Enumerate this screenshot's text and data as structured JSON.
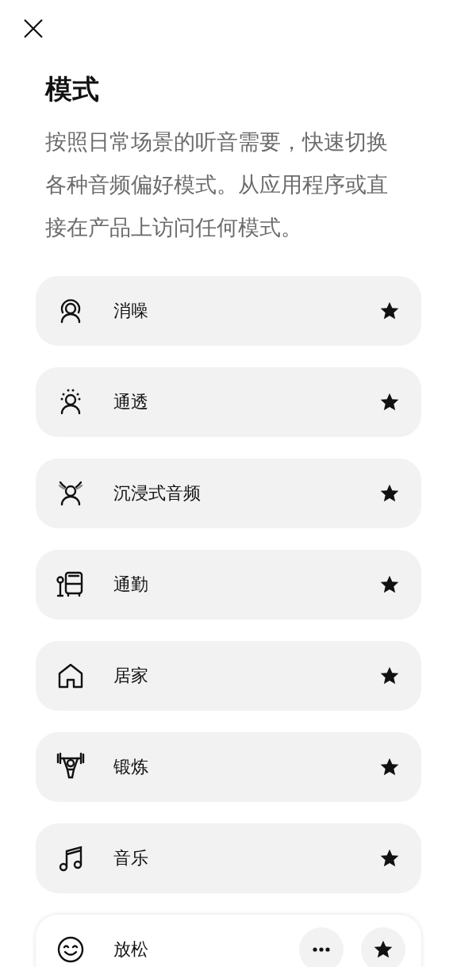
{
  "title": "模式",
  "description": "按照日常场景的听音需要，快速切换各种音频偏好模式。从应用程序或直接在产品上访问任何模式。",
  "modes": [
    {
      "kind": "noise",
      "label": "消噪",
      "selected": false
    },
    {
      "kind": "aware",
      "label": "通透",
      "selected": false
    },
    {
      "kind": "immersive",
      "label": "沉浸式音频",
      "selected": false
    },
    {
      "kind": "commute",
      "label": "通勤",
      "selected": false
    },
    {
      "kind": "home",
      "label": "居家",
      "selected": false
    },
    {
      "kind": "workout",
      "label": "锻炼",
      "selected": false
    },
    {
      "kind": "music",
      "label": "音乐",
      "selected": false
    },
    {
      "kind": "relax",
      "label": "放松",
      "selected": true
    }
  ]
}
